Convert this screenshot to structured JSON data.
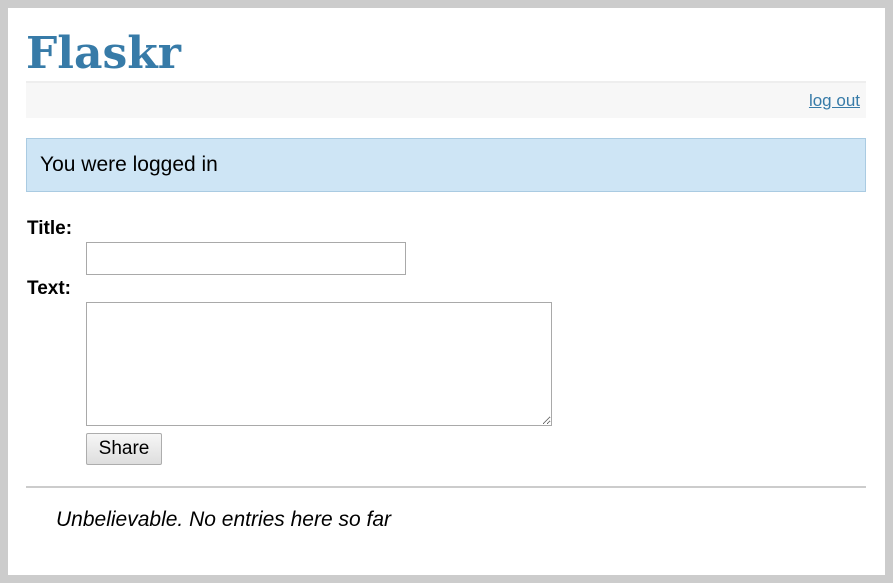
{
  "app": {
    "title": "Flaskr"
  },
  "metanav": {
    "logout_label": "log out"
  },
  "flash": {
    "message": "You were logged in"
  },
  "form": {
    "title_label": "Title:",
    "title_value": "",
    "text_label": "Text:",
    "text_value": "",
    "submit_label": "Share"
  },
  "entries": {
    "items": [],
    "empty_message": "Unbelievable. No entries here so far"
  },
  "colors": {
    "brand": "#377ba8",
    "flash_bg": "#cee5f5",
    "flash_border": "#aacbe2",
    "outer_bg": "#cccccc"
  }
}
